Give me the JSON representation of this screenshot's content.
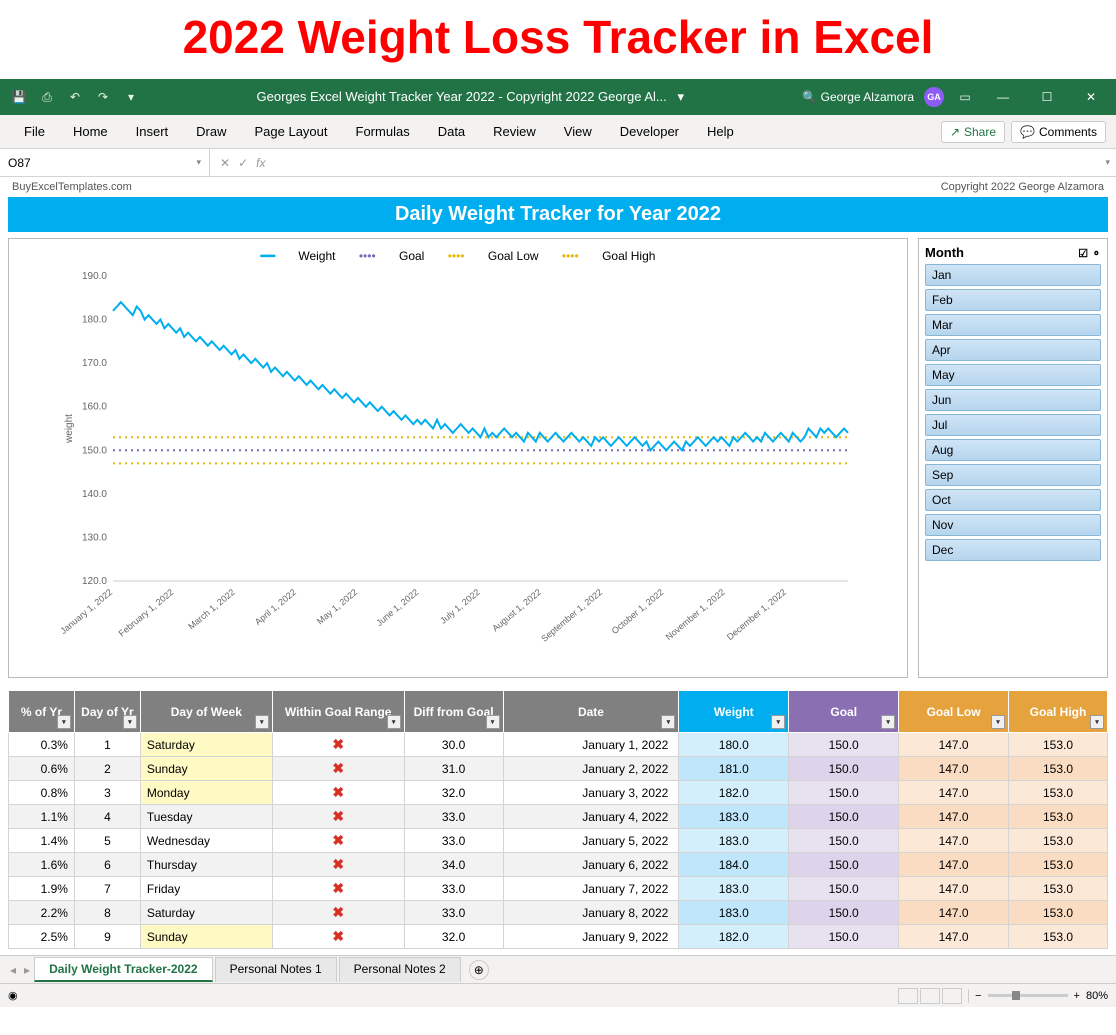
{
  "page_heading": "2022 Weight Loss Tracker in Excel",
  "titlebar": {
    "doc_title": "Georges Excel Weight Tracker Year 2022 - Copyright 2022 George Al...",
    "user_name": "George Alzamora",
    "user_initials": "GA"
  },
  "ribbon_tabs": [
    "File",
    "Home",
    "Insert",
    "Draw",
    "Page Layout",
    "Formulas",
    "Data",
    "Review",
    "View",
    "Developer",
    "Help"
  ],
  "ribbon_actions": {
    "share": "Share",
    "comments": "Comments"
  },
  "name_box": "O87",
  "sheet_meta": {
    "left": "BuyExcelTemplates.com",
    "right": "Copyright 2022  George Alzamora"
  },
  "chart_banner": "Daily Weight Tracker for Year 2022",
  "legend": {
    "weight": "Weight",
    "goal": "Goal",
    "goal_low": "Goal Low",
    "goal_high": "Goal High"
  },
  "chart_data": {
    "type": "line",
    "ylabel": "weight",
    "ylim": [
      120,
      190
    ],
    "yticks": [
      120.0,
      130.0,
      140.0,
      150.0,
      160.0,
      170.0,
      180.0,
      190.0
    ],
    "x_categories": [
      "January 1, 2022",
      "February 1, 2022",
      "March 1, 2022",
      "April 1, 2022",
      "May 1, 2022",
      "June 1, 2022",
      "July 1, 2022",
      "August 1, 2022",
      "September 1, 2022",
      "October 1, 2022",
      "November 1, 2022",
      "December 1, 2022"
    ],
    "series": [
      {
        "name": "Weight",
        "style": "solid",
        "color": "#00aeef",
        "values": [
          182,
          183,
          184,
          183,
          182,
          181,
          183,
          182,
          180,
          181,
          180,
          179,
          180,
          178,
          179,
          178,
          177,
          178,
          176,
          177,
          176,
          175,
          176,
          175,
          174,
          175,
          174,
          173,
          174,
          173,
          172,
          173,
          171,
          172,
          171,
          170,
          171,
          170,
          169,
          170,
          168,
          169,
          168,
          167,
          168,
          167,
          166,
          167,
          166,
          165,
          166,
          165,
          164,
          165,
          164,
          163,
          164,
          163,
          162,
          163,
          162,
          161,
          162,
          161,
          160,
          161,
          160,
          159,
          160,
          159,
          158,
          159,
          158,
          157,
          158,
          157,
          156,
          157,
          156,
          157,
          156,
          155,
          157,
          155,
          156,
          155,
          154,
          155,
          156,
          155,
          154,
          155,
          154,
          153,
          155,
          153,
          154,
          153,
          154,
          155,
          154,
          153,
          154,
          153,
          152,
          154,
          153,
          152,
          154,
          153,
          152,
          153,
          154,
          153,
          152,
          153,
          154,
          153,
          152,
          153,
          152,
          151,
          153,
          152,
          153,
          152,
          151,
          152,
          153,
          152,
          151,
          152,
          153,
          152,
          151,
          152,
          150,
          151,
          152,
          151,
          150,
          151,
          152,
          151,
          150,
          152,
          151,
          152,
          153,
          152,
          151,
          152,
          153,
          152,
          153,
          152,
          151,
          153,
          152,
          153,
          154,
          153,
          152,
          153,
          152,
          154,
          153,
          152,
          153,
          154,
          153,
          152,
          154,
          153,
          152,
          153,
          155,
          154,
          153,
          155,
          154,
          155,
          154,
          153,
          154,
          155,
          154
        ]
      },
      {
        "name": "Goal",
        "style": "dotted",
        "color": "#7b68b8",
        "constant": 150.0
      },
      {
        "name": "Goal Low",
        "style": "dotted",
        "color": "#e6b800",
        "constant": 147.0
      },
      {
        "name": "Goal High",
        "style": "dotted",
        "color": "#e6b800",
        "constant": 153.0
      }
    ]
  },
  "slicer": {
    "title": "Month",
    "items": [
      "Jan",
      "Feb",
      "Mar",
      "Apr",
      "May",
      "Jun",
      "Jul",
      "Aug",
      "Sep",
      "Oct",
      "Nov",
      "Dec"
    ]
  },
  "table": {
    "columns": [
      "% of Yr",
      "Day of Yr",
      "Day of Week",
      "Within Goal Range",
      "Diff from Goal",
      "Date",
      "Weight",
      "Goal",
      "Goal Low",
      "Goal High"
    ],
    "rows": [
      {
        "pct": "0.3%",
        "day": "1",
        "dow": "Saturday",
        "weekend": true,
        "ok": "✖",
        "diff": "30.0",
        "date": "January 1, 2022",
        "w": "180.0",
        "g": "150.0",
        "gl": "147.0",
        "gh": "153.0"
      },
      {
        "pct": "0.6%",
        "day": "2",
        "dow": "Sunday",
        "weekend": true,
        "ok": "✖",
        "diff": "31.0",
        "date": "January 2, 2022",
        "w": "181.0",
        "g": "150.0",
        "gl": "147.0",
        "gh": "153.0"
      },
      {
        "pct": "0.8%",
        "day": "3",
        "dow": "Monday",
        "weekend": true,
        "ok": "✖",
        "diff": "32.0",
        "date": "January 3, 2022",
        "w": "182.0",
        "g": "150.0",
        "gl": "147.0",
        "gh": "153.0"
      },
      {
        "pct": "1.1%",
        "day": "4",
        "dow": "Tuesday",
        "weekend": false,
        "ok": "✖",
        "diff": "33.0",
        "date": "January 4, 2022",
        "w": "183.0",
        "g": "150.0",
        "gl": "147.0",
        "gh": "153.0"
      },
      {
        "pct": "1.4%",
        "day": "5",
        "dow": "Wednesday",
        "weekend": false,
        "ok": "✖",
        "diff": "33.0",
        "date": "January 5, 2022",
        "w": "183.0",
        "g": "150.0",
        "gl": "147.0",
        "gh": "153.0"
      },
      {
        "pct": "1.6%",
        "day": "6",
        "dow": "Thursday",
        "weekend": false,
        "ok": "✖",
        "diff": "34.0",
        "date": "January 6, 2022",
        "w": "184.0",
        "g": "150.0",
        "gl": "147.0",
        "gh": "153.0"
      },
      {
        "pct": "1.9%",
        "day": "7",
        "dow": "Friday",
        "weekend": false,
        "ok": "✖",
        "diff": "33.0",
        "date": "January 7, 2022",
        "w": "183.0",
        "g": "150.0",
        "gl": "147.0",
        "gh": "153.0"
      },
      {
        "pct": "2.2%",
        "day": "8",
        "dow": "Saturday",
        "weekend": false,
        "ok": "✖",
        "diff": "33.0",
        "date": "January 8, 2022",
        "w": "183.0",
        "g": "150.0",
        "gl": "147.0",
        "gh": "153.0"
      },
      {
        "pct": "2.5%",
        "day": "9",
        "dow": "Sunday",
        "weekend": true,
        "ok": "✖",
        "diff": "32.0",
        "date": "January 9, 2022",
        "w": "182.0",
        "g": "150.0",
        "gl": "147.0",
        "gh": "153.0"
      }
    ]
  },
  "sheet_tabs": [
    "Daily Weight Tracker-2022",
    "Personal Notes 1",
    "Personal Notes 2"
  ],
  "status": {
    "zoom": "80%"
  }
}
